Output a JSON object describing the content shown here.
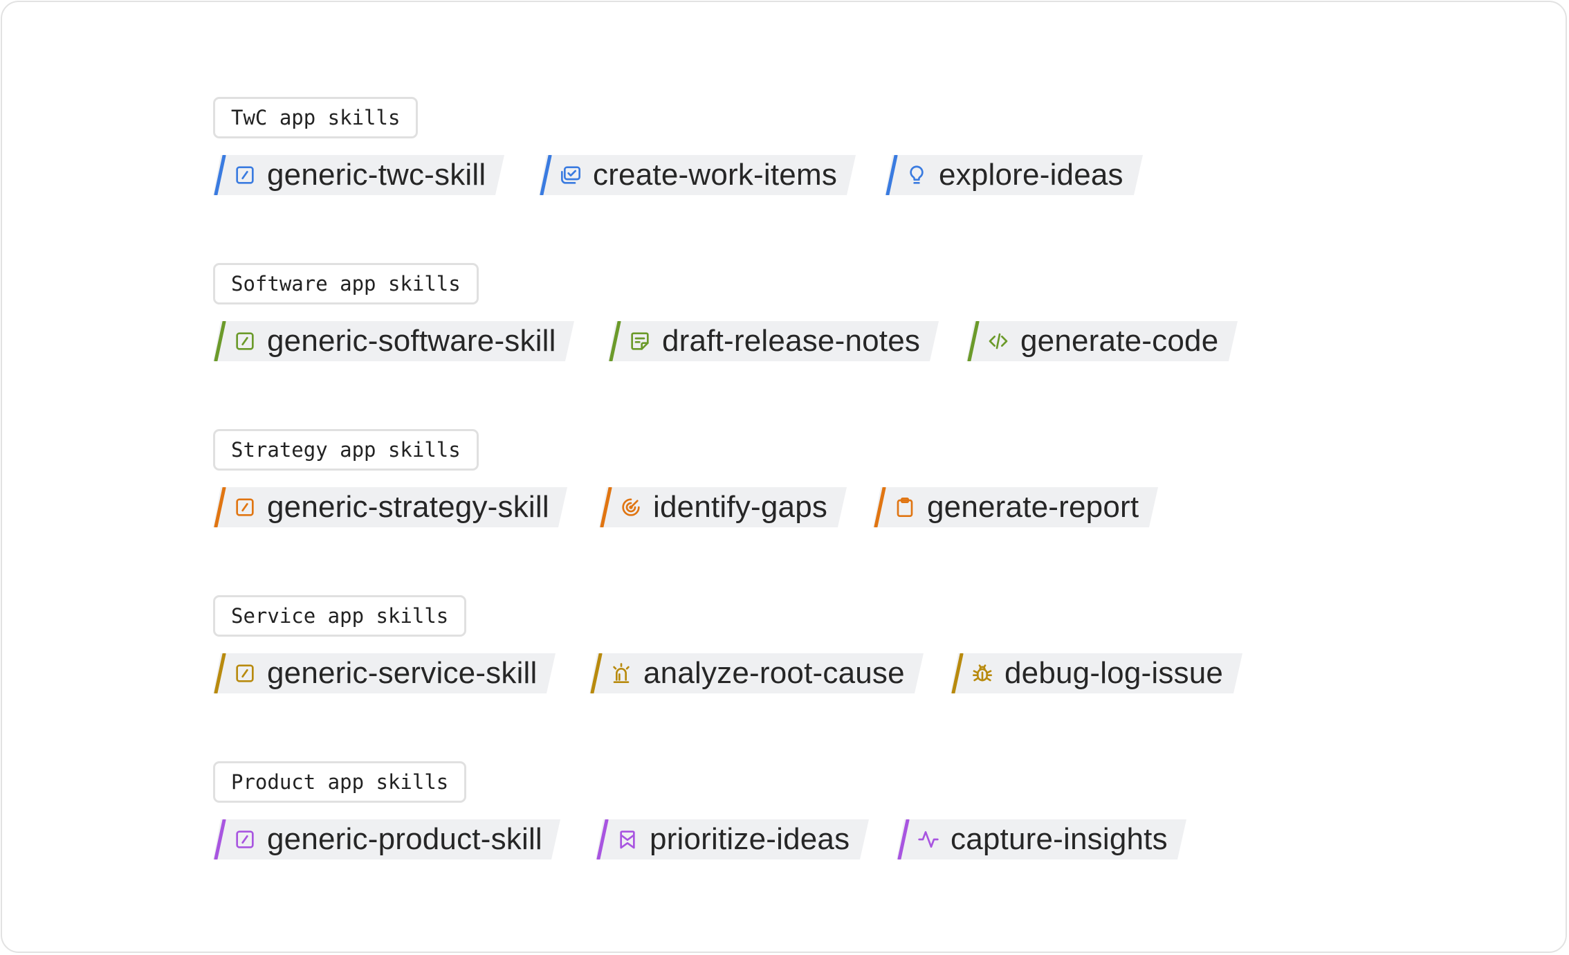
{
  "groups": [
    {
      "label": "TwC app skills",
      "color": "#3a7be0",
      "chips": [
        {
          "text": "generic-twc-skill",
          "icon": "square-slash-icon"
        },
        {
          "text": "create-work-items",
          "icon": "checklist-stack-icon"
        },
        {
          "text": "explore-ideas",
          "icon": "lightbulb-icon"
        }
      ]
    },
    {
      "label": "Software app skills",
      "color": "#6b9a2a",
      "chips": [
        {
          "text": "generic-software-skill",
          "icon": "square-slash-icon"
        },
        {
          "text": "draft-release-notes",
          "icon": "sticky-note-icon"
        },
        {
          "text": "generate-code",
          "icon": "code-icon"
        }
      ]
    },
    {
      "label": "Strategy app skills",
      "color": "#e07512",
      "chips": [
        {
          "text": "generic-strategy-skill",
          "icon": "square-slash-icon"
        },
        {
          "text": "identify-gaps",
          "icon": "radar-icon"
        },
        {
          "text": "generate-report",
          "icon": "clipboard-icon"
        }
      ]
    },
    {
      "label": "Service app skills",
      "color": "#b88a0e",
      "chips": [
        {
          "text": "generic-service-skill",
          "icon": "square-slash-icon"
        },
        {
          "text": "analyze-root-cause",
          "icon": "siren-icon"
        },
        {
          "text": "debug-log-issue",
          "icon": "bug-icon"
        }
      ]
    },
    {
      "label": "Product app skills",
      "color": "#a855e0",
      "chips": [
        {
          "text": "generic-product-skill",
          "icon": "square-slash-icon"
        },
        {
          "text": "prioritize-ideas",
          "icon": "bookmark-icon"
        },
        {
          "text": "capture-insights",
          "icon": "pulse-icon"
        }
      ]
    }
  ]
}
